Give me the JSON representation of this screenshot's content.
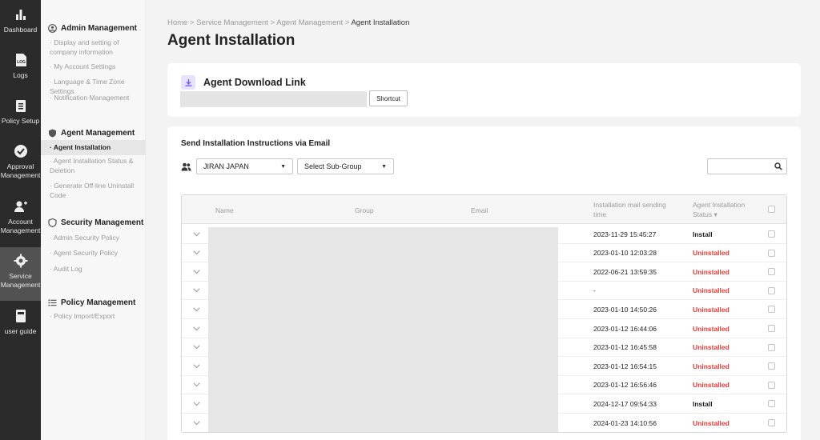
{
  "rail": [
    {
      "label": "Dashboard",
      "icon": "bar-chart-icon"
    },
    {
      "label": "Logs",
      "icon": "log-file-icon"
    },
    {
      "label": "Policy Setup",
      "icon": "clipboard-icon"
    },
    {
      "label": "Approval Management",
      "icon": "check-circle-icon"
    },
    {
      "label": "Account Management",
      "icon": "user-add-icon"
    },
    {
      "label": "Service Management",
      "icon": "gear-icon",
      "active": true
    },
    {
      "label": "user guide",
      "icon": "book-icon"
    }
  ],
  "submenu": {
    "admin": {
      "title": "Admin Management",
      "items": [
        "· Display and setting of company information",
        "· My Account Settings",
        "· Language & Time Zone Settings",
        "· Notification Management"
      ]
    },
    "agent": {
      "title": "Agent Management",
      "items": [
        "· Agent Installation",
        "· Agent Installation Status & Deletion",
        "· Generate Off-line Uninstall Code"
      ]
    },
    "security": {
      "title": "Security Management",
      "items": [
        "· Admin Security Policy",
        "· Agent Security Policy",
        "· Audit Log"
      ]
    },
    "policy": {
      "title": "Policy Management",
      "items": [
        "· Policy Import/Export"
      ]
    }
  },
  "breadcrumb": {
    "path": "Home > Service Management > Agent Management > ",
    "current": "Agent Installation"
  },
  "page_title": "Agent Installation",
  "download": {
    "title": "Agent Download Link",
    "shortcut_label": "Shortcut"
  },
  "send": {
    "title": "Send Installation Instructions via Email",
    "group_select": "JIRAN JAPAN",
    "subgroup_select": "Select Sub-Group",
    "search_placeholder": ""
  },
  "table": {
    "headers": {
      "name": "Name",
      "group": "Group",
      "email": "Email",
      "time_line1": "Installation mail sending",
      "time_line2": "time",
      "status_line1": "Agent Installation",
      "status_line2": "Status ▾"
    },
    "rows": [
      {
        "time": "2023-11-29 15:45:27",
        "status": "Install"
      },
      {
        "time": "2023-01-10 12:03:28",
        "status": "Uninstalled"
      },
      {
        "time": "2022-06-21 13:59:35",
        "status": "Uninstalled"
      },
      {
        "time": "-",
        "status": "Uninstalled"
      },
      {
        "time": "2023-01-10 14:50:26",
        "status": "Uninstalled"
      },
      {
        "time": "2023-01-12 16:44:06",
        "status": "Uninstalled"
      },
      {
        "time": "2023-01-12 16:45:58",
        "status": "Uninstalled"
      },
      {
        "time": "2023-01-12 16:54:15",
        "status": "Uninstalled"
      },
      {
        "time": "2023-01-12 16:56:46",
        "status": "Uninstalled"
      },
      {
        "time": "2024-12-17 09:54:33",
        "status": "Install"
      },
      {
        "time": "2024-01-23 14:10:56",
        "status": "Uninstalled"
      }
    ]
  },
  "colors": {
    "rail_bg": "#2b2b2b",
    "rail_active": "#525252",
    "uninstalled": "#e53935",
    "download_icon": "#7c5cff"
  }
}
